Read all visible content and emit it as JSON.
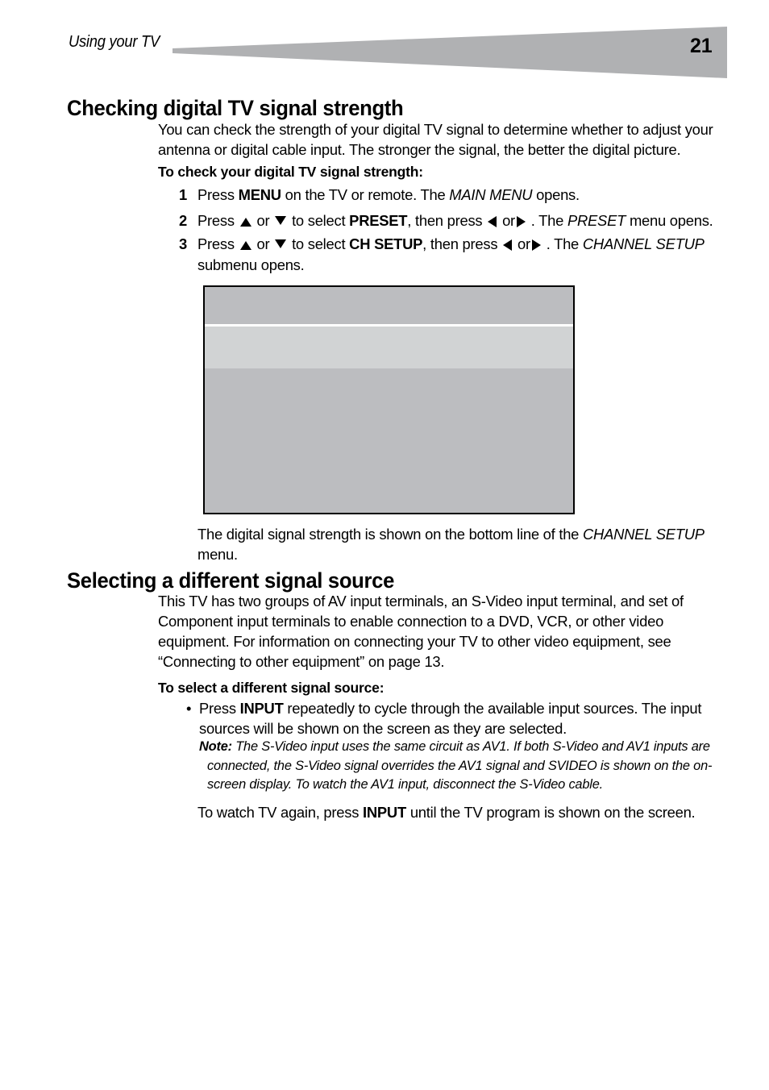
{
  "header": {
    "running_title": "Using your TV",
    "page_number": "21",
    "wedge_color": "#b0b1b3"
  },
  "sections": [
    {
      "heading": "Checking digital TV signal strength",
      "intro": "You can check the strength of your digital TV signal to determine whether to adjust your antenna or digital cable input. The stronger the signal, the better the digital picture.",
      "runin": "To check your digital TV signal strength:",
      "steps": [
        {
          "number": "1",
          "parts": [
            {
              "t": "Press ",
              "style": "normal"
            },
            {
              "t": "MENU",
              "style": "bold"
            },
            {
              "t": " on the TV or remote. The ",
              "style": "normal"
            },
            {
              "t": "MAIN MENU",
              "style": "italic"
            },
            {
              "t": " opens.",
              "style": "normal"
            }
          ]
        },
        {
          "number": "2",
          "parts": [
            {
              "t": "Press ",
              "style": "normal"
            },
            {
              "t": "",
              "style": "arrow-up"
            },
            {
              "t": " or ",
              "style": "normal"
            },
            {
              "t": "",
              "style": "arrow-down"
            },
            {
              "t": " to select ",
              "style": "normal"
            },
            {
              "t": "PRESET",
              "style": "bold"
            },
            {
              "t": ", then press ",
              "style": "normal"
            },
            {
              "t": "",
              "style": "arrow-left"
            },
            {
              "t": " or",
              "style": "normal"
            },
            {
              "t": "",
              "style": "arrow-right"
            },
            {
              "t": " . The ",
              "style": "normal"
            },
            {
              "t": "PRESET",
              "style": "italic"
            },
            {
              "t": " menu opens.",
              "style": "normal"
            }
          ]
        },
        {
          "number": "3",
          "parts": [
            {
              "t": "Press ",
              "style": "normal"
            },
            {
              "t": "",
              "style": "arrow-up"
            },
            {
              "t": " or ",
              "style": "normal"
            },
            {
              "t": "",
              "style": "arrow-down"
            },
            {
              "t": " to select ",
              "style": "normal"
            },
            {
              "t": "CH SETUP",
              "style": "bold"
            },
            {
              "t": ", then press ",
              "style": "normal"
            },
            {
              "t": "",
              "style": "arrow-left"
            },
            {
              "t": " or",
              "style": "normal"
            },
            {
              "t": "",
              "style": "arrow-right"
            },
            {
              "t": " . The ",
              "style": "normal"
            },
            {
              "t": "CHANNEL SETUP",
              "style": "italic"
            },
            {
              "t": " submenu opens.",
              "style": "normal"
            }
          ]
        }
      ],
      "figure": {
        "alt": "CHANNEL SETUP on-screen menu illustration",
        "top_band_color": "#bcbdc0",
        "divider_color": "#ffffff",
        "highlight_band_color": "#d1d3d4",
        "body_color": "#bcbdc0",
        "border_color": "#000000"
      },
      "caption_parts": [
        {
          "t": "The digital signal strength is shown on the bottom line of the ",
          "style": "normal"
        },
        {
          "t": "CHANNEL SETUP",
          "style": "italic"
        },
        {
          "t": " menu.",
          "style": "normal"
        }
      ]
    },
    {
      "heading": "Selecting a different signal source",
      "intro": "This TV has two groups of AV input terminals, an S-Video input terminal, and set of Component input terminals to enable connection to a DVD, VCR, or other video equipment. For information on connecting your TV to other video equipment, see “Connecting to other equipment” on page 13.",
      "runin": "To select a different signal source:",
      "bullet": {
        "marker": "•",
        "parts": [
          {
            "t": "Press ",
            "style": "normal"
          },
          {
            "t": "INPUT",
            "style": "bold"
          },
          {
            "t": " repeatedly to cycle through the available input sources. The input sources will be shown on the screen as they are selected.",
            "style": "normal"
          }
        ]
      },
      "note": {
        "label": "Note:",
        "text": "The S-Video input uses the same circuit as AV1. If both S-Video and AV1 inputs are connected, the S-Video signal overrides the AV1 signal and SVIDEO is shown on the on-screen display. To watch the AV1 input, disconnect the S-Video cable."
      },
      "closing_parts": [
        {
          "t": "To watch TV again, press ",
          "style": "normal"
        },
        {
          "t": "INPUT",
          "style": "bold"
        },
        {
          "t": " until the TV program is shown on the screen.",
          "style": "normal"
        }
      ]
    }
  ]
}
